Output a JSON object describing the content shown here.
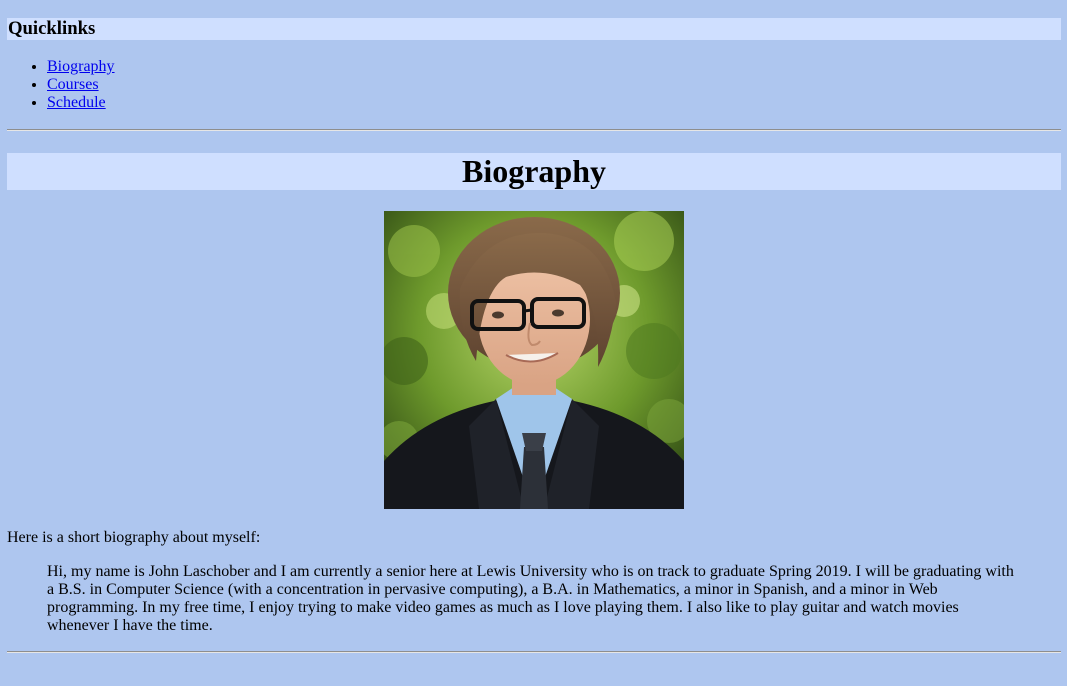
{
  "quicklinks": {
    "title": "Quicklinks",
    "links": [
      "Biography",
      "Courses",
      "Schedule"
    ]
  },
  "biography": {
    "title": "Biography",
    "intro": "Here is a short biography about myself:",
    "text": "Hi, my name is John Laschober and I am currently a senior here at Lewis University who is on track to graduate Spring 2019. I will be graduating with a B.S. in Computer Science (with a concentration in pervasive computing), a B.A. in Mathematics, a minor in Spanish, and a minor in Web programming. In my free time, I enjoy trying to make video games as much as I love playing them. I also like to play guitar and watch movies whenever I have the time."
  },
  "colors": {
    "page_background": "#aec6ef",
    "heading_background": "#cfdfff",
    "link": "#0000ee"
  }
}
